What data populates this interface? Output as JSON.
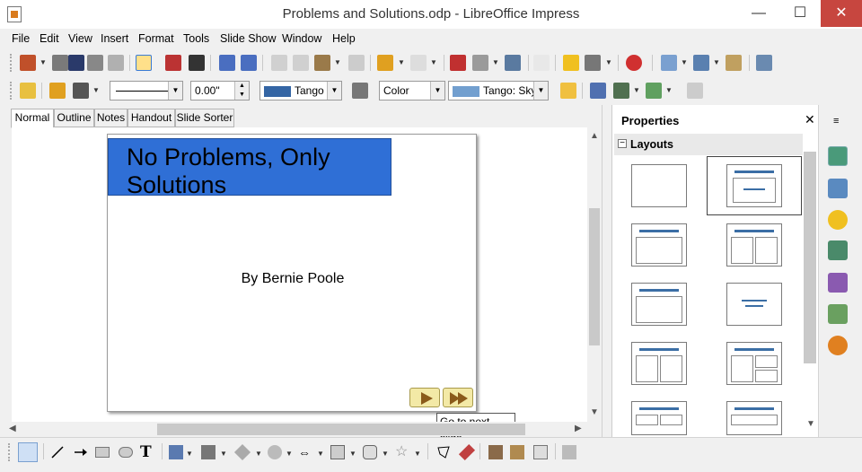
{
  "window": {
    "title": "Problems and Solutions.odp - LibreOffice Impress",
    "minimize": "—",
    "maximize": "☐",
    "close": "✕"
  },
  "menu": [
    "File",
    "Edit",
    "View",
    "Insert",
    "Format",
    "Tools",
    "Slide Show",
    "Window",
    "Help"
  ],
  "toolbar2": {
    "line_width": "0.00\"",
    "line_color": "Tango",
    "area_style": "Color",
    "area_color": "Tango: Sky"
  },
  "tabs": [
    "Normal",
    "Outline",
    "Notes",
    "Handout",
    "Slide Sorter"
  ],
  "slide": {
    "title_line1": "No Problems, Only",
    "title_line2": "Solutions",
    "subtitle": "By Bernie Poole"
  },
  "tooltip": "Go to next slide",
  "sidebar": {
    "title": "Properties",
    "close": "✕",
    "section": "Layouts",
    "collapse": "−"
  },
  "colors": {
    "title_box": "#2f6fd6",
    "nav_button": "#f3e9a6",
    "close_button": "#c7463f"
  }
}
